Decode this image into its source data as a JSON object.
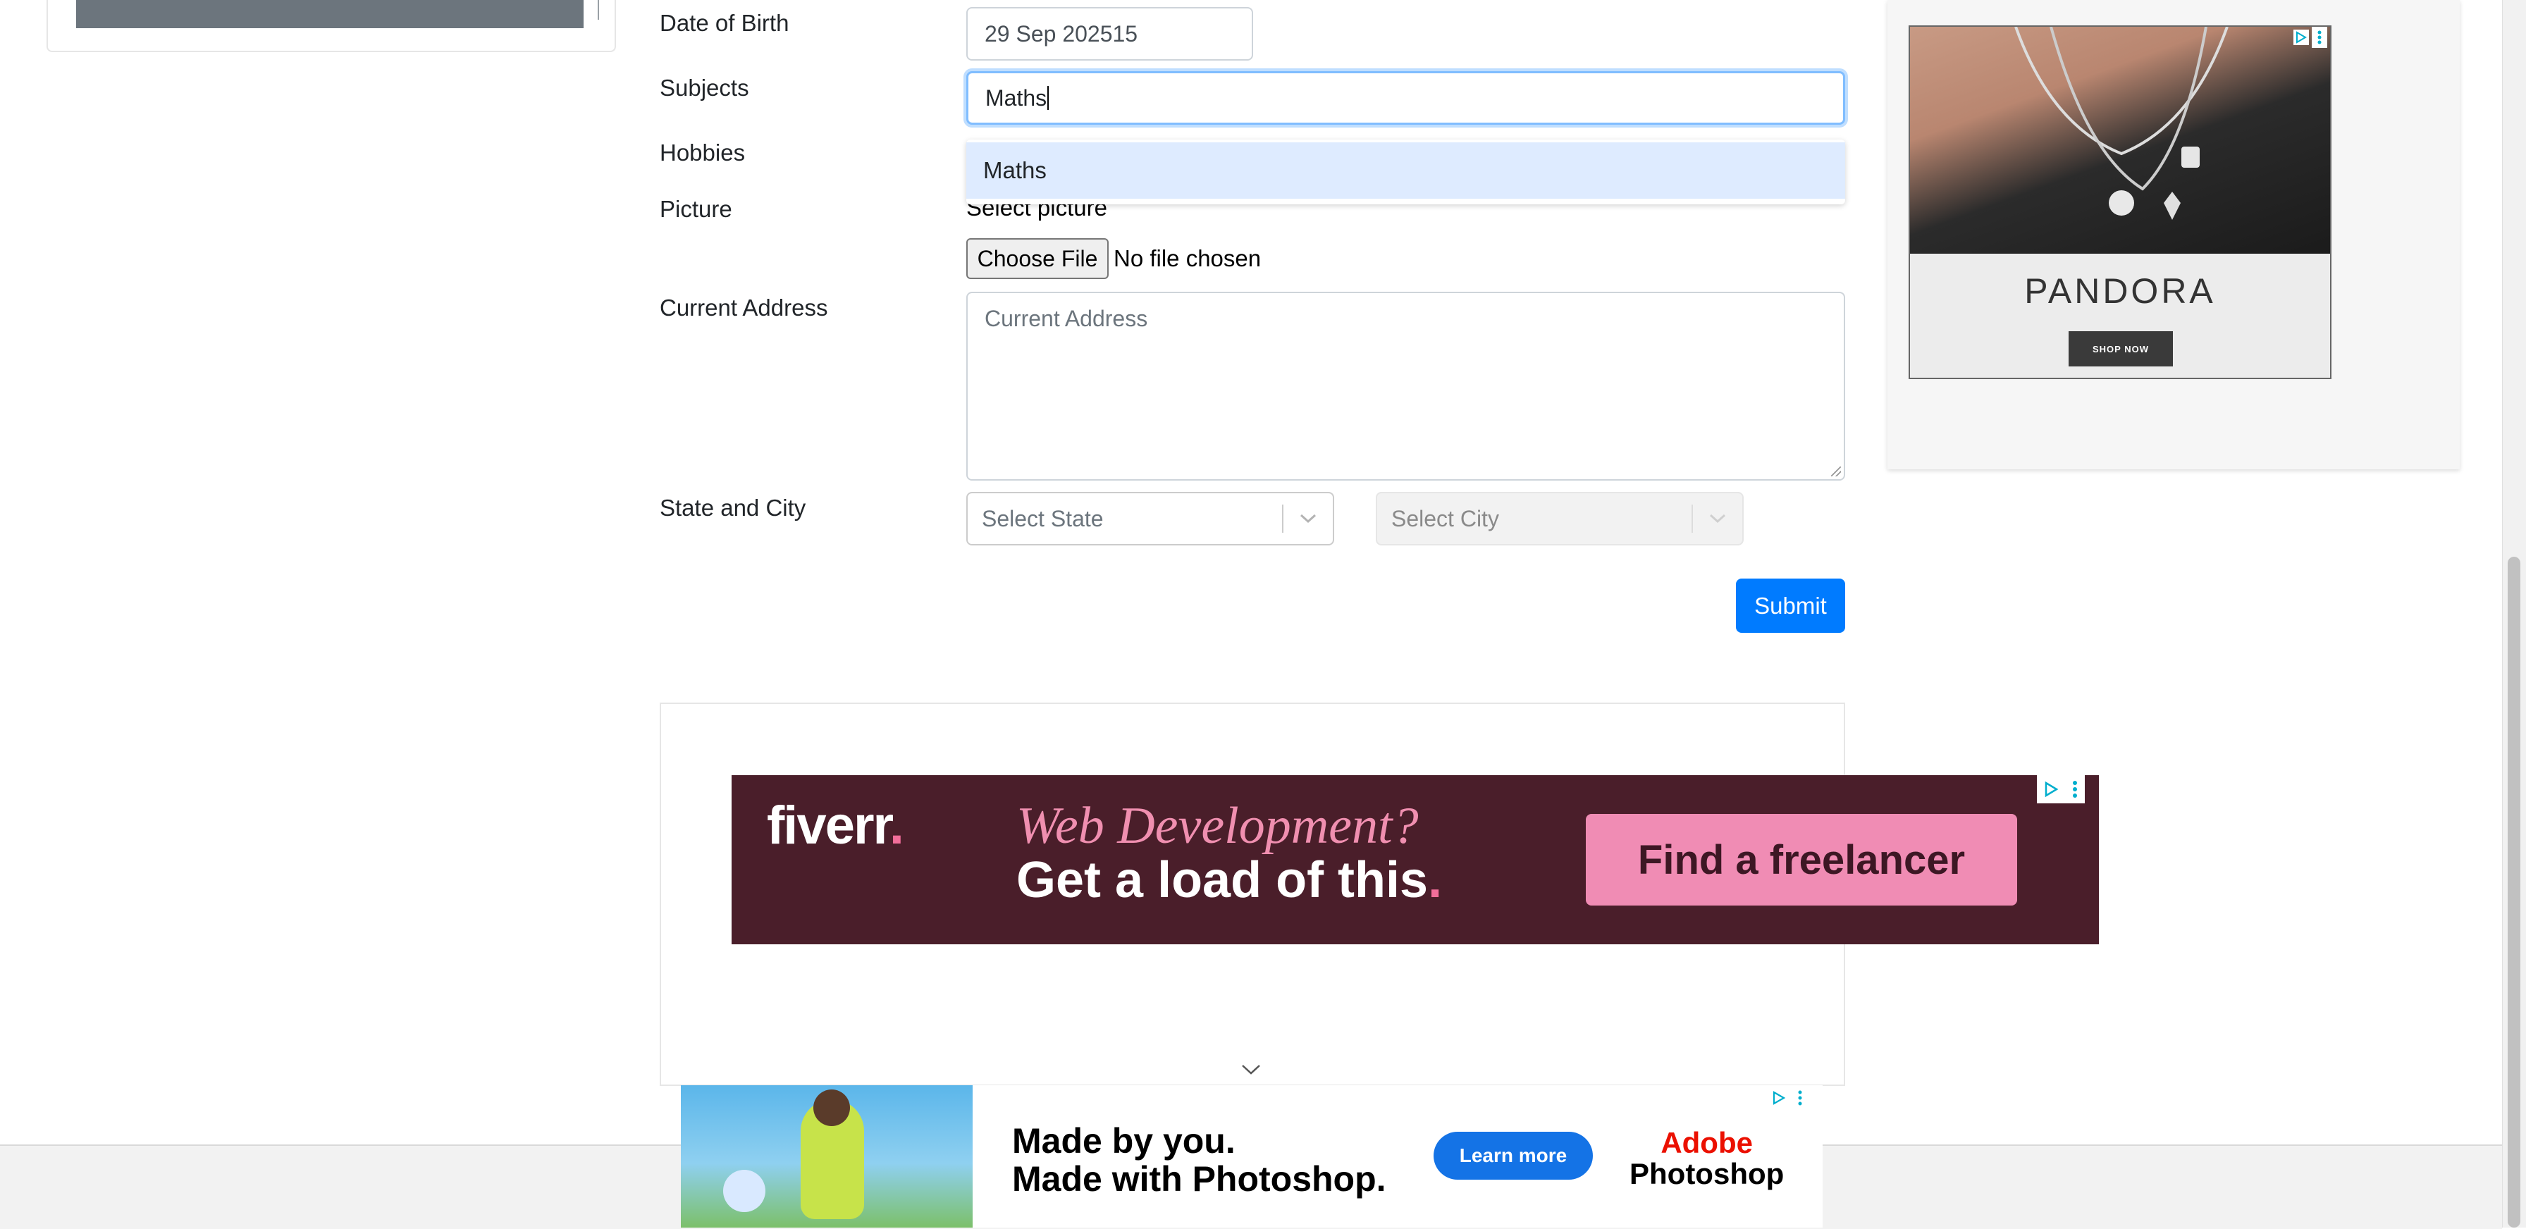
{
  "form": {
    "dob_label": "Date of Birth",
    "dob_value": "29 Sep 202515",
    "subjects_label": "Subjects",
    "subjects_value": "Maths",
    "subjects_option": "Maths",
    "hobbies_label": "Hobbies",
    "picture_label": "Picture",
    "select_picture": "Select picture",
    "choose_file": "Choose File",
    "no_file": "No file chosen",
    "address_label": "Current Address",
    "address_placeholder": "Current Address",
    "state_city_label": "State and City",
    "state_placeholder": "Select State",
    "city_placeholder": "Select City",
    "submit_label": "Submit"
  },
  "ads": {
    "fiverr": {
      "logo": "fiverr",
      "line1": "Web Development?",
      "line2": "Get a load of this",
      "cta": "Find a freelancer"
    },
    "pandora": {
      "brand": "PANDORA",
      "cta": "SHOP NOW"
    },
    "photoshop": {
      "line1": "Made by you.",
      "line2": "Made with Photoshop.",
      "cta": "Learn more",
      "brand1": "Adobe",
      "brand2": "Photoshop"
    }
  },
  "colors": {
    "primary": "#007bff",
    "focus_border": "#80bdff",
    "option_highlight": "#deebff",
    "fiverr_bg": "#4a1e2a",
    "fiverr_pink": "#f08cb4",
    "adobe_red": "#eb1000",
    "adobe_blue": "#1473e6"
  },
  "icons": [
    "chevron-down-icon",
    "adchoices-icon",
    "more-vert-icon",
    "resize-grip-icon"
  ]
}
